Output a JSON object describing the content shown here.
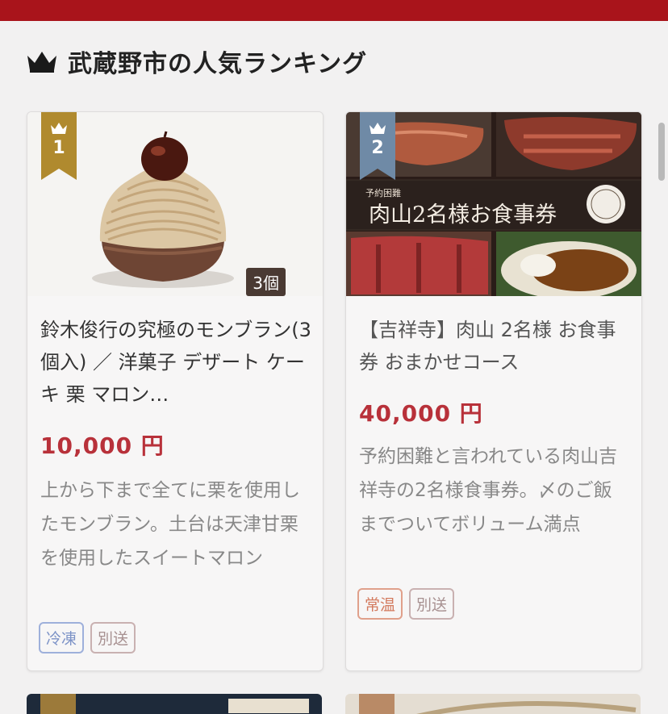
{
  "header": {
    "title": "武蔵野市の人気ランキング",
    "accent_color": "#a9141b"
  },
  "ranking": [
    {
      "rank": "1",
      "badge_color": "#b08a2e",
      "image_icon": "mont-blanc-cake-photo",
      "quantity_badge": "3個",
      "title": "鈴木俊行の究極のモンブラン(3個入) ／ 洋菓子 デザート ケーキ 栗 マロン…",
      "price": "10,000 円",
      "description": "上から下まで全てに栗を使用したモンブラン。土台は天津甘栗を使用したスイートマロン",
      "tags": [
        "冷凍",
        "別送"
      ]
    },
    {
      "rank": "2",
      "badge_color": "#6f8aa6",
      "image_icon": "steak-meal-ticket-photo",
      "image_caption": "肉山2名様お食事券",
      "title": "【吉祥寺】肉山 2名様 お食事券 おまかせコース",
      "price": "40,000 円",
      "description": "予約困難と言われている肉山吉祥寺の2名様食事券。〆のご飯までついてボリューム満点",
      "tags": [
        "常温",
        "別送"
      ]
    }
  ]
}
